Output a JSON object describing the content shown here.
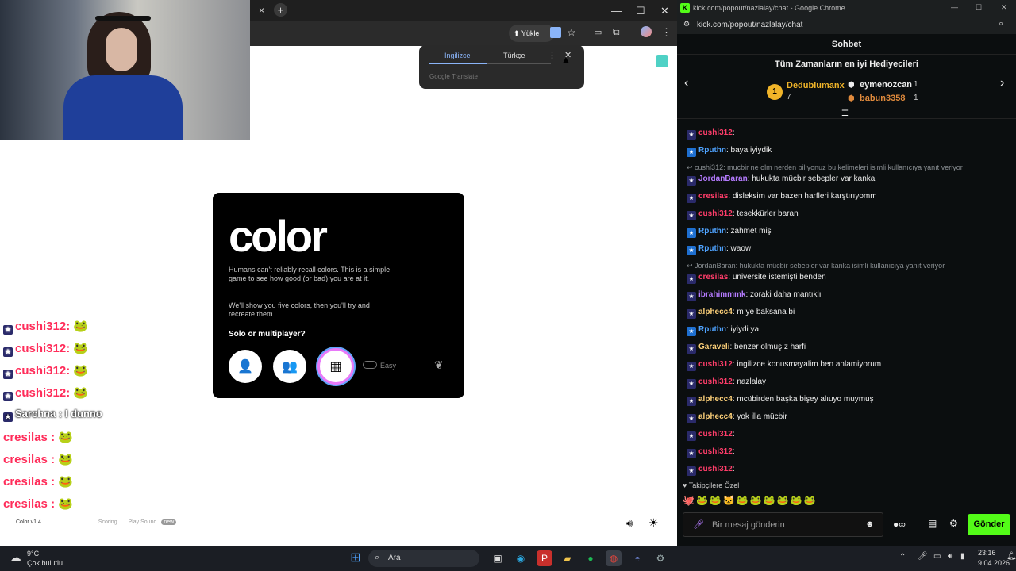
{
  "left_browser": {
    "new_tab": "+",
    "close_tab": "×",
    "window_buttons": [
      "—",
      "☐",
      "✕"
    ],
    "upload_label": "Yükle",
    "translate_popup": {
      "tab_english": "İngilizce",
      "tab_turkish": "Türkçe",
      "footer": "Google Translate"
    },
    "game": {
      "title": "color",
      "desc1": "Humans can't reliably recall colors. This is a simple game to see how good (or bad) you are at it.",
      "desc2": "We'll show you five colors, then you'll try and recreate them.",
      "question": "Solo or multiplayer?",
      "easy_label": "Easy"
    },
    "footer": {
      "version": "Color v1.4",
      "links": [
        "Scoring",
        "Play Sound"
      ],
      "new_badge": "new"
    },
    "overlay_chat": [
      {
        "user": "cushi312",
        "text": ":"
      },
      {
        "user": "cushi312",
        "text": ":"
      },
      {
        "user": "cushi312",
        "text": ":"
      },
      {
        "user": "cushi312",
        "text": ":"
      },
      {
        "user": "Sarchna",
        "text": ": I dunno"
      },
      {
        "user": "cresilas",
        "text": ":"
      },
      {
        "user": "cresilas",
        "text": ":"
      },
      {
        "user": "cresilas",
        "text": ":"
      },
      {
        "user": "cresilas",
        "text": ":"
      }
    ]
  },
  "right_browser": {
    "window_title": "kick.com/popout/nazlalay/chat - Google Chrome",
    "url": "kick.com/popout/nazlalay/chat",
    "chat_title": "Sohbet",
    "gifters_title": "Tüm Zamanların en iyi Hediyecileri",
    "gifters": [
      {
        "rank": "1",
        "name": "Dedublumanx",
        "count": "7"
      },
      {
        "name": "eymenozcan",
        "count": "1"
      },
      {
        "name": "babun3358",
        "count": "1"
      }
    ],
    "messages": [
      {
        "kind": "msg",
        "user": "cushi312",
        "color": "#ff3d6a",
        "text": ":"
      },
      {
        "kind": "msg",
        "user": "Rputhn",
        "color": "#4fa3ff",
        "text": ": baya iyiydik"
      },
      {
        "kind": "reply",
        "text": "cushi312: mucbir ne olm nerden biliyonuz bu kelimeleri isimli kullanıcıya yanıt veriyor"
      },
      {
        "kind": "msg",
        "user": "JordanBaran",
        "color": "#b57bff",
        "text": ": hukukta mücbir sebepler var kanka"
      },
      {
        "kind": "msg",
        "user": "cresilas",
        "color": "#ff3d6a",
        "text": ": disleksim var bazen harfleri karştırıyomm"
      },
      {
        "kind": "msg",
        "user": "cushi312",
        "color": "#ff3d6a",
        "text": ": tesekkürler baran"
      },
      {
        "kind": "msg",
        "user": "Rputhn",
        "color": "#4fa3ff",
        "text": ": zahmet miş"
      },
      {
        "kind": "msg",
        "user": "Rputhn",
        "color": "#4fa3ff",
        "text": ": waow"
      },
      {
        "kind": "reply",
        "text": "JordanBaran: hukukta mücbir sebepler var kanka isimli kullanıcıya yanıt veriyor"
      },
      {
        "kind": "msg",
        "user": "cresilas",
        "color": "#ff3d6a",
        "text": ": üniversite istemişti benden"
      },
      {
        "kind": "msg",
        "user": "ibrahimmmk",
        "color": "#b57bff",
        "text": ": zoraki daha mantıklı"
      },
      {
        "kind": "msg",
        "user": "alphecc4",
        "color": "#ffd27a",
        "text": ": m ye baksana bi"
      },
      {
        "kind": "msg",
        "user": "Rputhn",
        "color": "#4fa3ff",
        "text": ": iyiydi ya"
      },
      {
        "kind": "msg",
        "user": "Garaveli",
        "color": "#ffd27a",
        "text": ": benzer olmuş z harfi"
      },
      {
        "kind": "msg",
        "user": "cushi312",
        "color": "#ff3d6a",
        "text": ": ingilizce konusmayalim ben anlamiyorum"
      },
      {
        "kind": "msg",
        "user": "cushi312",
        "color": "#ff3d6a",
        "text": ": nazlalay"
      },
      {
        "kind": "msg",
        "user": "alphecc4",
        "color": "#ffd27a",
        "text": ": mcübirden başka bişey alıuyo muymuş"
      },
      {
        "kind": "msg",
        "user": "alphecc4",
        "color": "#ffd27a",
        "text": ": yok illa mücbir"
      },
      {
        "kind": "msg",
        "user": "cushi312",
        "color": "#ff3d6a",
        "text": ":"
      },
      {
        "kind": "msg",
        "user": "cushi312",
        "color": "#ff3d6a",
        "text": ":"
      },
      {
        "kind": "msg",
        "user": "cushi312",
        "color": "#ff3d6a",
        "text": ":"
      }
    ],
    "followers_only": "Takipçilere Özel",
    "input_placeholder": "Bir mesaj gönderin",
    "send_label": "Gönder"
  },
  "taskbar": {
    "weather_temp": "9°C",
    "weather_desc": "Çok bulutlu",
    "search_label": "Ara",
    "time": "23:16",
    "date": "9.04.2026"
  },
  "colors": {
    "kick_green": "#53fc18",
    "accent_blue": "#8ab4f8"
  }
}
